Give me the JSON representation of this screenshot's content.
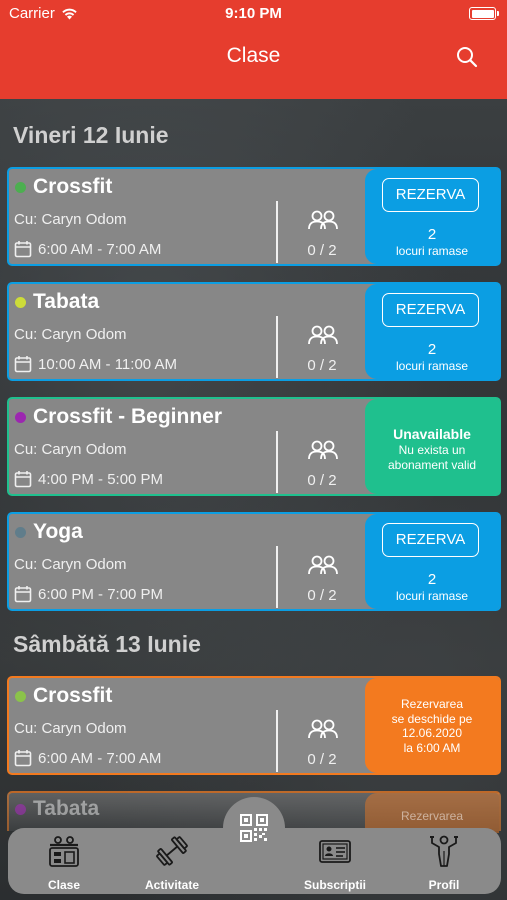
{
  "status_bar": {
    "carrier": "Carrier",
    "time": "9:10 PM"
  },
  "header": {
    "title": "Clase",
    "search_icon": "search-icon"
  },
  "colors": {
    "header": "#e63d2e",
    "blue": "#0b9ee3",
    "green": "#1fc08e",
    "orange": "#f37a1f",
    "card_bg": "#878787"
  },
  "days": [
    {
      "title": "Vineri 12 Iunie",
      "classes": [
        {
          "name": "Crossfit",
          "dot_color": "#4caf50",
          "teacher": "Cu: Caryn Odom",
          "time": "6:00 AM - 7:00 AM",
          "count": "0 / 2",
          "action_type": "reserve",
          "button": "REZERVA",
          "spots": "2",
          "spots_label": "locuri ramase"
        },
        {
          "name": "Tabata",
          "dot_color": "#cddc39",
          "teacher": "Cu: Caryn Odom",
          "time": "10:00 AM - 11:00 AM",
          "count": "0 / 2",
          "action_type": "reserve",
          "button": "REZERVA",
          "spots": "2",
          "spots_label": "locuri ramase"
        },
        {
          "name": "Crossfit - Beginner",
          "dot_color": "#9c27b0",
          "teacher": "Cu: Caryn Odom",
          "time": "4:00 PM - 5:00 PM",
          "count": "0 / 2",
          "action_type": "unavailable",
          "unavailable_title": "Unavailable",
          "unavailable_sub_1": "Nu exista un",
          "unavailable_sub_2": "abonament valid"
        },
        {
          "name": "Yoga",
          "dot_color": "#607d8b",
          "teacher": "Cu: Caryn Odom",
          "time": "6:00 PM - 7:00 PM",
          "count": "0 / 2",
          "action_type": "reserve",
          "button": "REZERVA",
          "spots": "2",
          "spots_label": "locuri ramase"
        }
      ]
    },
    {
      "title": "Sâmbătă 13 Iunie",
      "classes": [
        {
          "name": "Crossfit",
          "dot_color": "#8bc34a",
          "teacher": "Cu: Caryn Odom",
          "time": "6:00 AM - 7:00 AM",
          "count": "0 / 2",
          "action_type": "opens",
          "opens_1": "Rezervarea",
          "opens_2": "se deschide pe",
          "opens_3": "12.06.2020",
          "opens_4": "la 6:00 AM"
        },
        {
          "name": "Tabata",
          "partial": true,
          "opens_partial": "Rezervarea"
        }
      ]
    }
  ],
  "tab_bar": {
    "tabs": [
      {
        "label": "Clase",
        "icon": "class-schedule-icon"
      },
      {
        "label": "Activitate",
        "icon": "dumbbell-icon"
      },
      {
        "label": "Subscriptii",
        "icon": "membership-card-icon"
      },
      {
        "label": "Profil",
        "icon": "profile-trophy-icon"
      }
    ],
    "center_icon": "qr-code-icon"
  }
}
